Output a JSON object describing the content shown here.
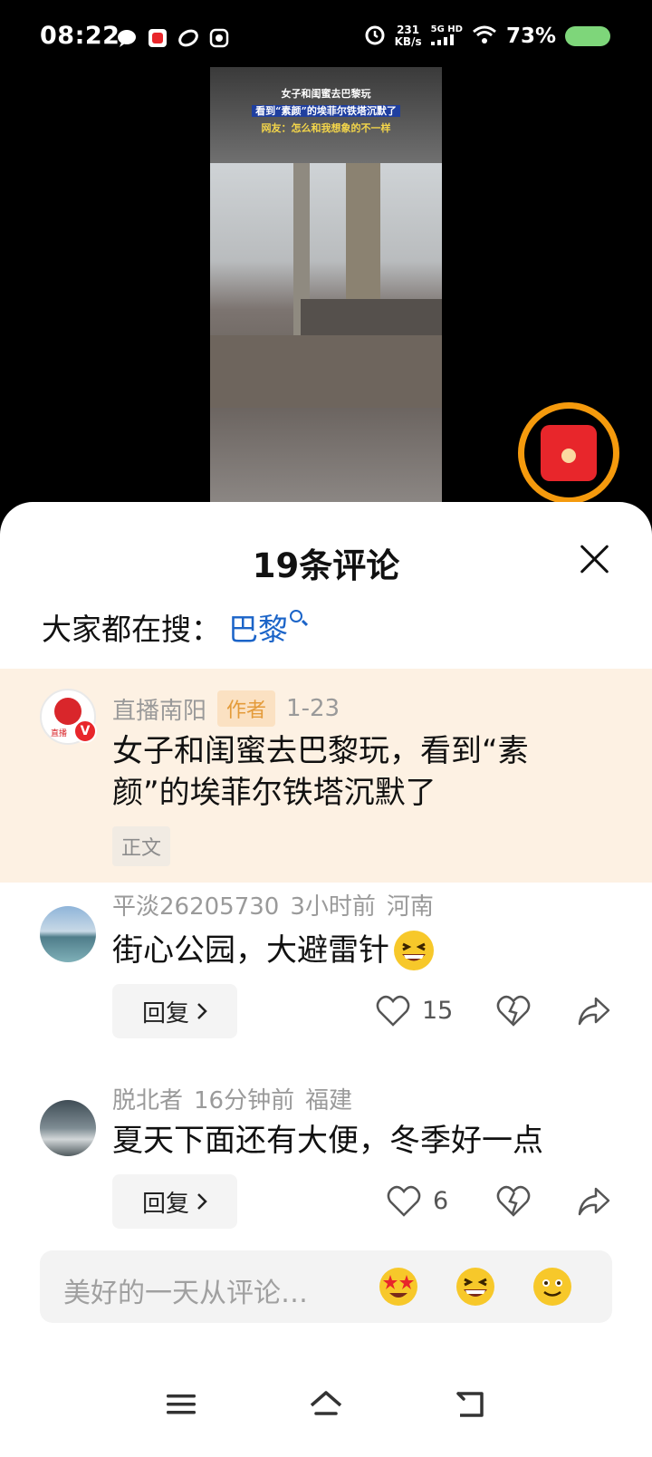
{
  "status_bar": {
    "time": "08:22",
    "net_speed_value": "231",
    "net_speed_unit": "KB/s",
    "network_label": "5G HD",
    "battery_percent": "73%",
    "icons": [
      "chat-bubble-icon",
      "app-red-icon",
      "app-link-icon",
      "app-screen-icon",
      "alarm-icon",
      "signal-icon",
      "wifi-icon",
      "battery-icon"
    ]
  },
  "video": {
    "caption_line1": "女子和闺蜜去巴黎玩",
    "caption_line2": "看到“素颜”的埃菲尔铁塔沉默了",
    "caption_line3": "网友：怎么和我想象的不一样"
  },
  "comments_panel": {
    "title": "19条评论",
    "search_prefix": "大家都在搜：",
    "search_term": "巴黎"
  },
  "pinned_comment": {
    "user": "直播南阳",
    "badge": "作者",
    "date": "1-23",
    "avatar_label": "直播",
    "verified": "V",
    "text_line1": "女子和闺蜜去巴黎玩，看到“素",
    "text_line2": "颜”的埃菲尔铁塔沉默了",
    "tag": "正文"
  },
  "comments": [
    {
      "user": "平淡26205730",
      "time": "3小时前",
      "location": "河南",
      "text": "街心公园，大避雷针",
      "emoji": "grin-emoji",
      "reply_label": "回复",
      "likes": "15"
    },
    {
      "user": "脱北者",
      "time": "16分钟前",
      "location": "福建",
      "text": "夏天下面还有大便，冬季好一点",
      "reply_label": "回复",
      "likes": "6"
    }
  ],
  "input": {
    "placeholder": "美好的一天从评论…",
    "emojis": [
      "star-eyes-emoji",
      "grin-emoji",
      "smile-emoji"
    ]
  },
  "colors": {
    "accent_blue": "#1b64c8",
    "pinned_bg": "#fdf1e3",
    "author_tag": "#e49b3a",
    "redpack_ring": "#f59a0d",
    "battery": "#7ed67a"
  }
}
